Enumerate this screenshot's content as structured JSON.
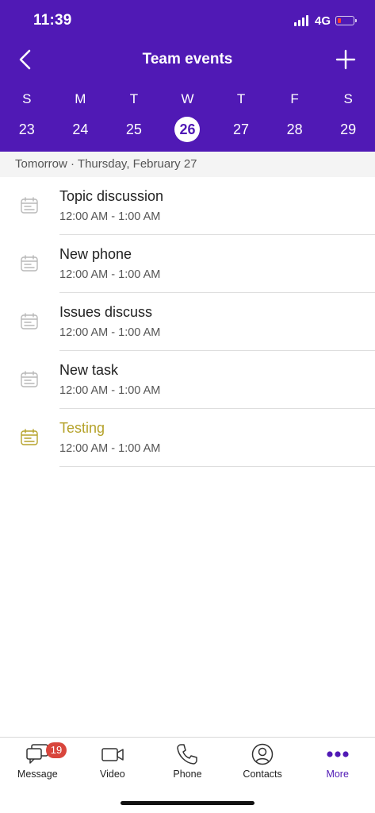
{
  "status_bar": {
    "time": "11:39",
    "network": "4G"
  },
  "header": {
    "title": "Team events"
  },
  "week": {
    "days": [
      "S",
      "M",
      "T",
      "W",
      "T",
      "F",
      "S"
    ],
    "dates": [
      "23",
      "24",
      "25",
      "26",
      "27",
      "28",
      "29"
    ],
    "selected_index": 3
  },
  "date_label": "Tomorrow · Thursday, February 27",
  "events": [
    {
      "title": "Topic discussion",
      "time": "12:00 AM - 1:00 AM",
      "highlight": false
    },
    {
      "title": "New phone",
      "time": "12:00 AM - 1:00 AM",
      "highlight": false
    },
    {
      "title": "Issues discuss",
      "time": "12:00 AM - 1:00 AM",
      "highlight": false
    },
    {
      "title": "New task",
      "time": "12:00 AM - 1:00 AM",
      "highlight": false
    },
    {
      "title": "Testing",
      "time": "12:00 AM - 1:00 AM",
      "highlight": true
    }
  ],
  "tabbar": {
    "message": {
      "label": "Message",
      "badge": "19"
    },
    "video": {
      "label": "Video"
    },
    "phone": {
      "label": "Phone"
    },
    "contacts": {
      "label": "Contacts"
    },
    "more": {
      "label": "More"
    }
  },
  "colors": {
    "brand": "#5019b5",
    "highlight": "#b5a22a",
    "badge": "#d8453c"
  },
  "icons": {
    "back": "chevron-left-icon",
    "add": "plus-icon",
    "event": "calendar-icon",
    "message": "chat-bubbles-icon",
    "video": "video-camera-icon",
    "phone": "phone-icon",
    "contacts": "person-circle-icon",
    "more": "three-dots-icon"
  }
}
